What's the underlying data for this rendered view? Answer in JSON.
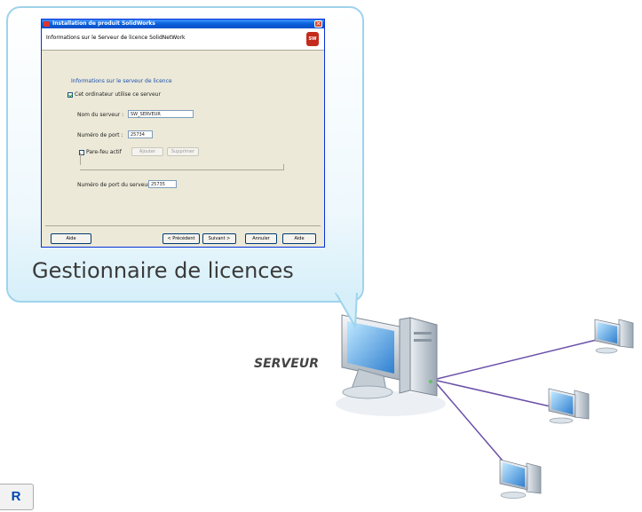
{
  "dialog": {
    "title": "Installation de produit SolidWorks",
    "header": "Informations sur le Serveur de licence SolidNetWork",
    "logo_text": "SW",
    "section_title": "Informations sur le serveur de licence",
    "checkbox_server_label": "Cet ordinateur utilise ce serveur",
    "server_name_label": "Nom du serveur :",
    "server_name_value": "SW_SERVEUR",
    "port_label": "Numéro de port :",
    "port_value": "25734",
    "firewall_label": "Pare-feu actif",
    "firewall_button_1": "Ajouter",
    "firewall_button_2": "Supprimer",
    "port_number_label": "Numéro de port du serveur :",
    "port_number_value": "25735",
    "buttons": {
      "help": "Aide",
      "back": "< Précédent",
      "next": "Suivant >",
      "cancel": "Annuler",
      "finish": "Aide"
    }
  },
  "caption": "Gestionnaire de licences",
  "server_label": "SERVEUR",
  "corner_button": "R"
}
